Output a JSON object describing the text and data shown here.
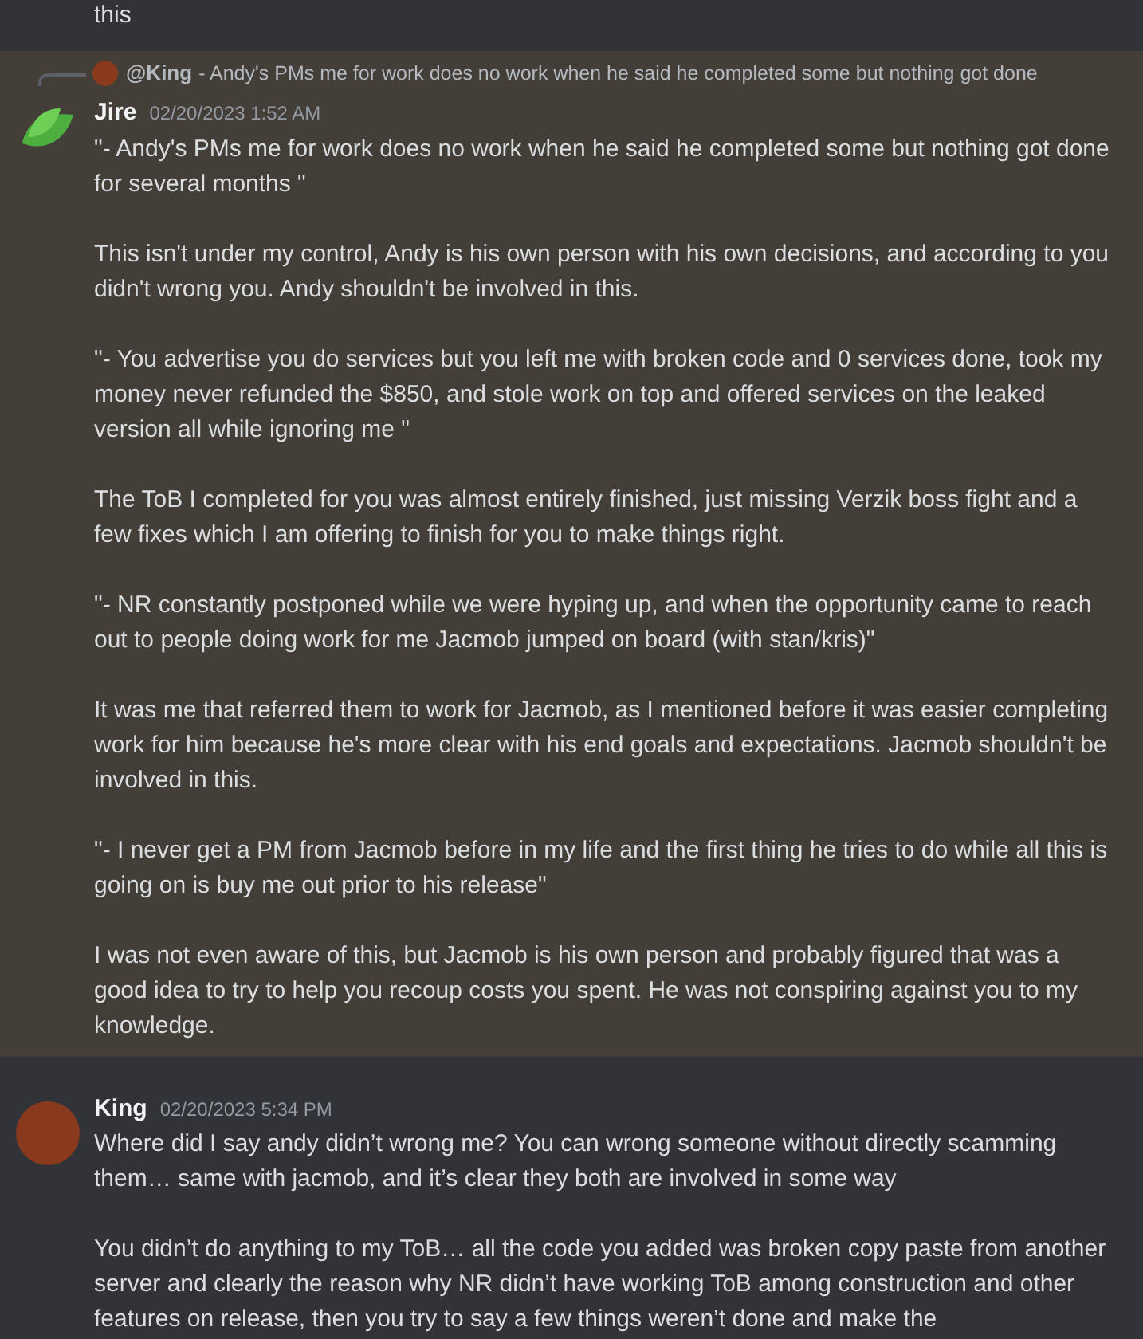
{
  "previous_message": {
    "last_line": "this"
  },
  "messages": [
    {
      "author": "Jire",
      "timestamp": "02/20/2023 1:52 AM",
      "highlighted": true,
      "reply": {
        "author": "@King",
        "text": "- Andy's PMs me for work does no work when he said he completed some but nothing got done"
      },
      "paragraphs": [
        "\"- Andy's PMs me for work does no work when he said he completed some but nothing got done for several months \"",
        "This isn't under my control, Andy is his own person with his own decisions, and according to you didn't wrong you. Andy shouldn't be involved in this.",
        "\"- You advertise you do services but you left me with broken code and 0 services done, took my money never refunded the $850, and stole work on top and offered services on the leaked version all while ignoring me \"",
        "The ToB I completed for you was almost entirely finished, just missing Verzik boss fight and a few fixes which I am offering to finish for you to make things right.",
        "\"- NR constantly postponed while we were hyping up, and when the opportunity came to reach out to people doing work for me Jacmob jumped on board (with stan/kris)\"",
        "It was me that referred them to work for Jacmob, as I mentioned before it was easier completing work for him because he's more clear with his end goals and expectations. Jacmob shouldn't be involved in this.",
        "\"- I never get a PM from Jacmob before in my life and the first thing he tries to do while all this is going on is buy me out prior to his release\"",
        "I was not even aware of this, but Jacmob is his own person and probably figured that was a good idea to try to help you recoup costs you spent. He was not conspiring against you to my knowledge."
      ]
    },
    {
      "author": "King",
      "timestamp": "02/20/2023 5:34 PM",
      "highlighted": false,
      "paragraphs": [
        "Where did I say andy didn’t wrong me? You can wrong someone without directly scamming them… same with jacmob, and it’s clear they both are involved in some way",
        "You didn’t do anything to my ToB… all the code you added was broken copy paste from another server and clearly the reason why NR didn’t have working ToB among construction and other features on release, then you try to say a few things weren’t done and make the"
      ]
    }
  ]
}
